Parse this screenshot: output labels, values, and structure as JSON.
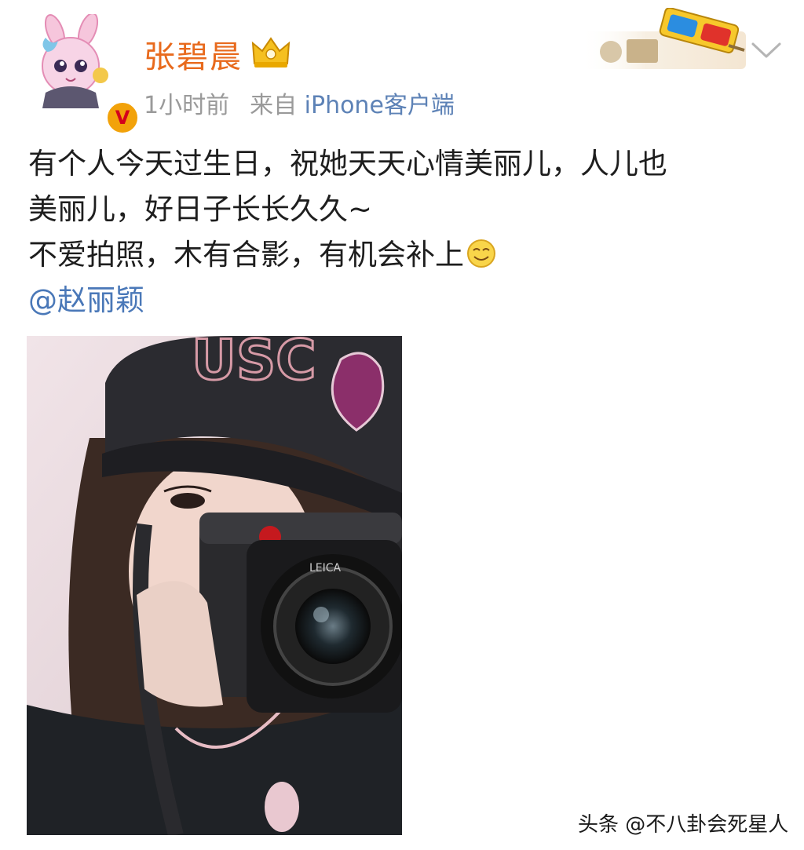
{
  "post": {
    "username": "张碧晨",
    "time": "1小时前",
    "source_prefix": "来自",
    "source_client": "iPhone客户端",
    "verified_badge": "V",
    "lines": [
      "有个人今天过生日，祝她天天心情美丽儿，人儿也",
      "美丽儿，好日子长长久久~",
      "不爱拍照，木有合影，有机会补上"
    ],
    "mention": "@赵丽颖",
    "photo_icon": "selfie-with-camera-photo",
    "camera_brand": "LEICA"
  },
  "icons": {
    "crown": "crown-icon",
    "chevron": "chevron-down-icon",
    "emoji": "smile-emoji-icon"
  },
  "watermark": "头条 @不八卦会死星人",
  "colors": {
    "username": "#e86a1d",
    "meta": "#9a9a9a",
    "link": "#4a78b8",
    "text": "#1e1e1e"
  }
}
